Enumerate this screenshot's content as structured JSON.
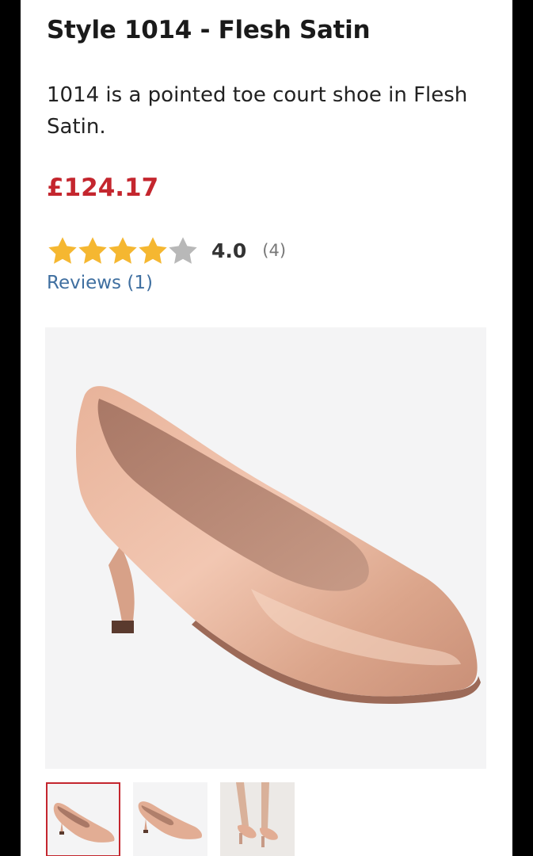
{
  "product": {
    "title": "Style 1014 - Flesh Satin",
    "description": "1014 is a pointed toe court shoe in Flesh Satin.",
    "price": "£124.17",
    "price_color": "#c4262e"
  },
  "rating": {
    "stars": 4,
    "max_stars": 5,
    "value": "4.0",
    "count": "(4)",
    "star_color": "#f5b731",
    "empty_star_color": "#b8b8b8"
  },
  "reviews_link": {
    "label": "Reviews (1)",
    "color": "#3f6fa0"
  },
  "gallery": {
    "main_image_icon": "flesh-satin-court-shoe-image",
    "thumbnails": [
      {
        "icon": "shoe-side-view-thumbnail",
        "selected": true
      },
      {
        "icon": "shoe-side-view-alt-thumbnail",
        "selected": false
      },
      {
        "icon": "shoe-worn-on-feet-thumbnail",
        "selected": false
      }
    ]
  }
}
